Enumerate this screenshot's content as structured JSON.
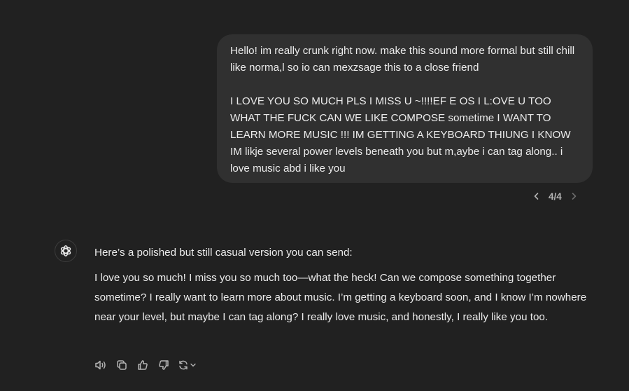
{
  "user_message": {
    "line1": "Hello! im really crunk right now. make this sound more formal but still chill like norma,l so io can mexzsage this to a close friend",
    "line2": "I LOVE YOU SO MUCH PLS I MISS U ~!!!!EF E  OS I L:OVE U TOO WHAT THE FUCK CAN WE LIKE COMPOSE sometime I WANT TO LEARN MORE MUSIC !!! IM GETTING A KEYBOARD THIUNG I KNOW IM likje several power levels beneath you but m,aybe i can tag along.. i love music abd i like you"
  },
  "pager": {
    "label": "4/4",
    "prev_icon": "chevron-left-icon",
    "next_icon": "chevron-right-icon"
  },
  "assistant": {
    "avatar_icon": "openai-logo-icon",
    "intro": "Here’s a polished but still casual version you can send:",
    "body": "I love you so much! I miss you so much too—what the heck! Can we compose something together sometime? I really want to learn more about music. I’m getting a keyboard soon, and I know I’m nowhere near your level, but maybe I can tag along? I really love music, and honestly, I really like you too.",
    "actions": [
      "speaker-icon",
      "copy-icon",
      "thumbs-up-icon",
      "thumbs-down-icon",
      "regenerate-icon",
      "chevron-down-icon"
    ]
  },
  "colors": {
    "background": "#212121",
    "bubble": "#303030",
    "text": "#ececec",
    "muted": "#b4b4b4"
  }
}
